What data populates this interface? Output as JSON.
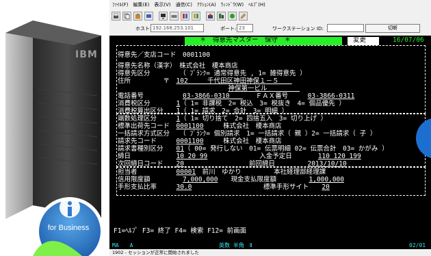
{
  "brand": {
    "logo_text": "IBM",
    "badge_text": "for Business"
  },
  "menubar": [
    "ﾌｧｲﾙ(F)",
    "編集(E)",
    "表示(V)",
    "通信(C)",
    "ｱｸｼｮﾝ(A)",
    "ｳｨﾝﾄﾞｳ(W)",
    "ﾍﾙﾌﾟ(H)"
  ],
  "connection": {
    "host_label": "ホスト:",
    "host_value": "192.168.253.101",
    "port_label": "ポート:",
    "port_value": "23",
    "ws_label": "ワークステーション ID:",
    "ws_value": "",
    "disconnect_label": "切断"
  },
  "screen": {
    "program_id": "CDM340 :3",
    "title": "＊　得意先マスター　保守　＊",
    "mode": "変更",
    "date": "16/07/06",
    "rows": [
      {
        "id": "r1",
        "segments": [
          {
            "t": "得意先／支店コード　",
            "c": "w"
          },
          {
            "t": "0001100",
            "c": "w"
          }
        ]
      },
      {
        "id": "r2",
        "segments": [
          {
            "t": "得意先名称（漢字）　",
            "c": "w"
          },
          {
            "t": "株式会社　榎本商店",
            "c": "w"
          }
        ]
      },
      {
        "id": "r3",
        "segments": [
          {
            "t": "得意先区分　　　　",
            "c": "w"
          },
          {
            "t": "　（ ﾌﾞﾗﾝｸ= 通常得意先 , 1= 雑得意先 ）",
            "c": "w"
          }
        ]
      },
      {
        "id": "r4",
        "segments": [
          {
            "t": "住所　　　　　〒　",
            "c": "w"
          },
          {
            "t": "102　　　千代田区神田神保１－５　　",
            "c": "w u"
          }
        ]
      },
      {
        "id": "r5",
        "segments": [
          {
            "t": "　　　　　　　　　　　　　　　　　",
            "c": "w"
          },
          {
            "t": "神保第一ビル　　　　　",
            "c": "w u"
          }
        ]
      },
      {
        "id": "r6",
        "segments": [
          {
            "t": "電話番号　　　　　　",
            "c": "w"
          },
          {
            "t": "03-3866-0310　　",
            "c": "w u"
          },
          {
            "t": "　　ＦＡＸ番号　　　",
            "c": "w"
          },
          {
            "t": "03-3866-0311",
            "c": "w u"
          }
        ]
      },
      {
        "id": "r7",
        "segments": [
          {
            "t": "消費税区分　　　　",
            "c": "w"
          },
          {
            "t": "1",
            "c": "w u"
          },
          {
            "t": "（ 1= 非課税　2= 税込　3= 税抜き　4= 個品優先 ）",
            "c": "w"
          }
        ]
      },
      {
        "id": "r8",
        "segments": [
          {
            "t": "消費税算出区分　　",
            "c": "w"
          },
          {
            "t": "1",
            "c": "w u"
          },
          {
            "t": "（ 1= 請求　2= 合計　3= 明細 ）",
            "c": "w"
          }
        ]
      },
      {
        "id": "r9",
        "segments": [
          {
            "t": "端数処理区分　　　",
            "c": "w"
          },
          {
            "t": "1",
            "c": "w u"
          },
          {
            "t": "（ 1= 切り捨て　2= 四捨五入　3= 切り上げ ）",
            "c": "w"
          }
        ]
      },
      {
        "id": "r10",
        "segments": [
          {
            "t": "標準出荷先コード　",
            "c": "w"
          },
          {
            "t": "0001100",
            "c": "w u"
          },
          {
            "t": "　　　株式会社　榎本商店",
            "c": "w"
          }
        ]
      },
      {
        "id": "r11",
        "segments": [
          {
            "t": "一括請求方式区分　",
            "c": "w"
          },
          {
            "t": "　（ ﾌﾞﾗﾝｸ= 個別請求　1= 一括請求（ 親 ）2= 一括請求（ 子 ）",
            "c": "w"
          }
        ]
      },
      {
        "id": "r12",
        "segments": [
          {
            "t": "請求先コード　　　",
            "c": "w"
          },
          {
            "t": "0001100",
            "c": "w u"
          },
          {
            "t": "　　　株式会社　榎本商店",
            "c": "w"
          }
        ]
      },
      {
        "id": "r13",
        "segments": [
          {
            "t": "請求書種別区分　　",
            "c": "w"
          },
          {
            "t": "01",
            "c": "w u"
          },
          {
            "t": "（ 00= 発行しない　01= 伝票明細 02= 伝票合計　03= かがみ ）",
            "c": "w"
          }
        ]
      },
      {
        "id": "r14",
        "segments": [
          {
            "t": "締日　　　　　　　",
            "c": "w"
          },
          {
            "t": "10 20 99",
            "c": "w u"
          },
          {
            "t": "　　　　　　　　入金予定日　　　　",
            "c": "w"
          },
          {
            "t": "110 120 199",
            "c": "w u"
          }
        ]
      },
      {
        "id": "r15",
        "segments": [
          {
            "t": "次回締日コード　　",
            "c": "w"
          },
          {
            "t": "20",
            "c": "w u"
          },
          {
            "t": "　　　　　　　　　　前回締日　　　　　",
            "c": "w"
          },
          {
            "t": "2013/10/10",
            "c": "w u"
          }
        ]
      },
      {
        "id": "r16",
        "segments": [
          {
            "t": "担当者　　　　　　",
            "c": "w"
          },
          {
            "t": "00001",
            "c": "w u"
          },
          {
            "t": "　前川　ゆかり　　　　　本社経理部経理課",
            "c": "w"
          }
        ]
      },
      {
        "id": "r17",
        "segments": [
          {
            "t": "信用限度額　　　　　",
            "c": "w"
          },
          {
            "t": "7,000,000",
            "c": "w u"
          },
          {
            "t": "　　現金支払限度額　　　　　",
            "c": "w"
          },
          {
            "t": "1,000,000",
            "c": "w u"
          }
        ]
      },
      {
        "id": "r18",
        "segments": [
          {
            "t": "手形支払比率　　　",
            "c": "w"
          },
          {
            "t": "30.0",
            "c": "w u"
          },
          {
            "t": "　　　　　　　　　　　標準手形サイト　　",
            "c": "w"
          },
          {
            "t": "20",
            "c": "w u"
          }
        ]
      }
    ],
    "function_keys": "F1=ﾍﾙﾌﾟ F3= 終了 F4= 検索 F12= 前画面",
    "status_left": "MA　　A",
    "status_center": "英数 半角　Ⅱ",
    "status_right": "02/01"
  },
  "status_message": "1902 - セッションが正常に開始されました",
  "colors": {
    "terminal_bg": "#000000",
    "terminal_text": "#26f026",
    "field_text": "#ffffff",
    "sphere": "#1c6fd1"
  }
}
